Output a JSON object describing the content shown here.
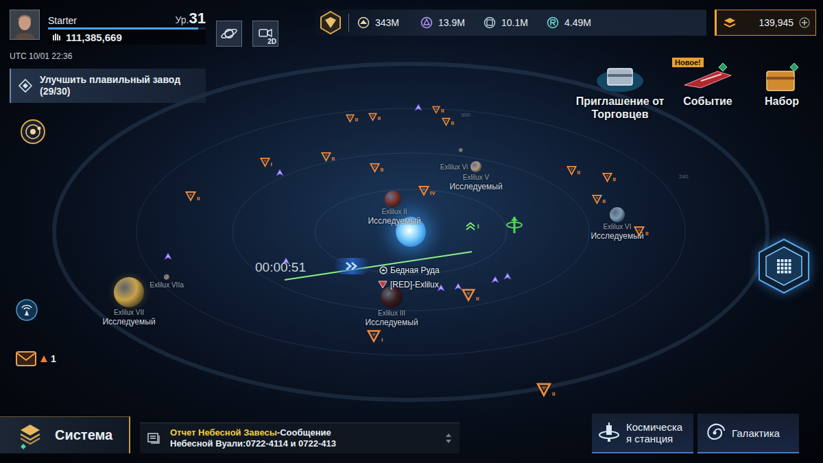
{
  "player": {
    "name": "Starter",
    "level_label": "Ур.",
    "level": "31",
    "power": "111,385,669",
    "time": "UTC 10/01 22:36",
    "xp": {
      "level": 0.95
    }
  },
  "view_toggle": {
    "label": "2D"
  },
  "resources": [
    {
      "value": "343M"
    },
    {
      "value": "13.9M"
    },
    {
      "value": "10.1M"
    },
    {
      "value": "4.49M"
    }
  ],
  "currency": {
    "value": "139,945"
  },
  "quest": {
    "title": "Улучшить плавильный завод",
    "progress": "(29/30)"
  },
  "shortcuts": [
    {
      "label": "Приглашение от Торговцев"
    },
    {
      "label": "Событие",
      "badge": "Новое!"
    },
    {
      "label": "Набор"
    }
  ],
  "mail": {
    "count": "1"
  },
  "map": {
    "timer": "00:00:51",
    "orbit_labels": [
      "300",
      "240"
    ],
    "planets": [
      {
        "name": "Exlilux VII",
        "status": "Исследуемый",
        "color": "#c9a24a"
      },
      {
        "name": "Exlilux VIIa",
        "color": "#9a8a78"
      },
      {
        "name": "Exlilux II",
        "status": "Исследуемый",
        "color": "#7a2f2a"
      },
      {
        "name": "Exlilux III",
        "status": "Исследуемый",
        "color": "#3a1a1e"
      },
      {
        "name": "Exlilux V",
        "status": "Исследуемый",
        "color": "#b09a80"
      },
      {
        "name": "Exlilux Vi",
        "color": "#8a7a70"
      },
      {
        "name": "Exlilux VI",
        "status": "Исследуемый",
        "color": "#7a9ab8"
      }
    ],
    "resource_label": "Бедная Руда",
    "fleet_label": "[RED]-Exlilux",
    "markers": [
      {
        "tier": "II"
      },
      {
        "tier": "II"
      },
      {
        "tier": "II"
      },
      {
        "tier": "II"
      },
      {
        "tier": "I"
      },
      {
        "tier": "II"
      },
      {
        "tier": "II"
      },
      {
        "tier": "II"
      },
      {
        "tier": "IV"
      },
      {
        "tier": "II"
      },
      {
        "tier": "II"
      },
      {
        "tier": "II"
      },
      {
        "tier": "II"
      },
      {
        "tier": "II"
      },
      {
        "tier": "I"
      },
      {
        "tier": "II"
      }
    ],
    "green_marker": {
      "tier": "I"
    }
  },
  "bottom": {
    "system_button": "Система",
    "chat": {
      "channel": "Отчет Небесной Завесы",
      "lines": [
        "-Сообщение",
        "Небесной Вуали:0722-4114 и 0722-413"
      ]
    },
    "nav": [
      {
        "label": "Космическая станция"
      },
      {
        "label": "Галактика"
      }
    ]
  }
}
